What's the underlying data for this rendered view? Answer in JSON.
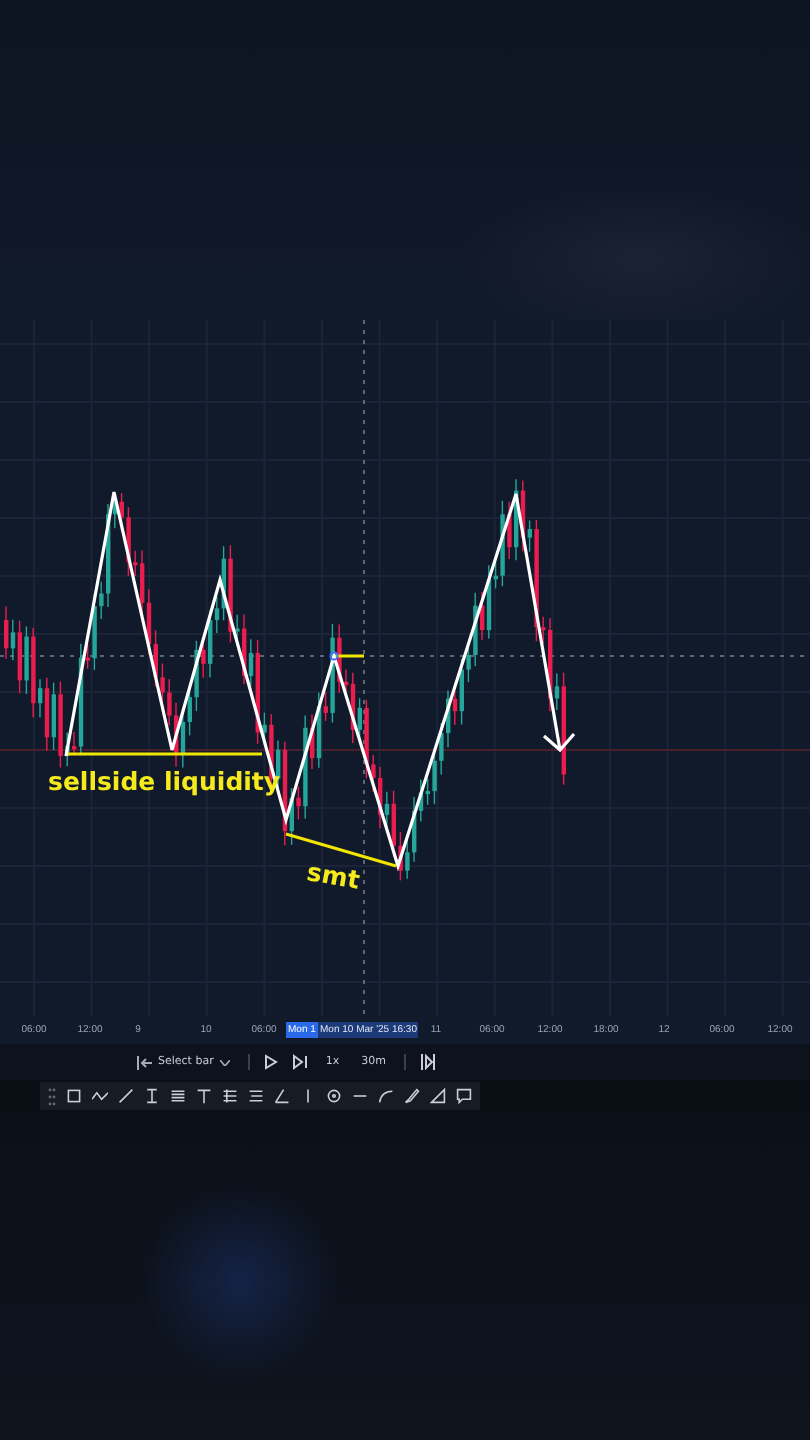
{
  "chart": {
    "annotations": [
      {
        "kind": "label",
        "text": "sellside liquidity"
      },
      {
        "kind": "label",
        "text": "smt"
      }
    ]
  },
  "time_axis": {
    "labels": [
      {
        "kind": "tick",
        "text": "06:00"
      },
      {
        "kind": "tick",
        "text": "12:00"
      },
      {
        "kind": "tick",
        "text": "9"
      },
      {
        "kind": "tick",
        "text": "10"
      },
      {
        "kind": "tick",
        "text": "06:00"
      },
      {
        "kind": "marker",
        "text": "Mon 1"
      },
      {
        "kind": "cursor",
        "text": "Mon 10 Mar '25 16:30"
      },
      {
        "kind": "tick",
        "text": "11"
      },
      {
        "kind": "tick",
        "text": "06:00"
      },
      {
        "kind": "tick",
        "text": "12:00"
      },
      {
        "kind": "tick",
        "text": "18:00"
      },
      {
        "kind": "tick",
        "text": "12"
      },
      {
        "kind": "tick",
        "text": "06:00"
      },
      {
        "kind": "tick",
        "text": "12:00"
      }
    ]
  },
  "replay_toolbar": {
    "select_bar": "Select bar",
    "speed": "1x",
    "interval": "30m"
  }
}
